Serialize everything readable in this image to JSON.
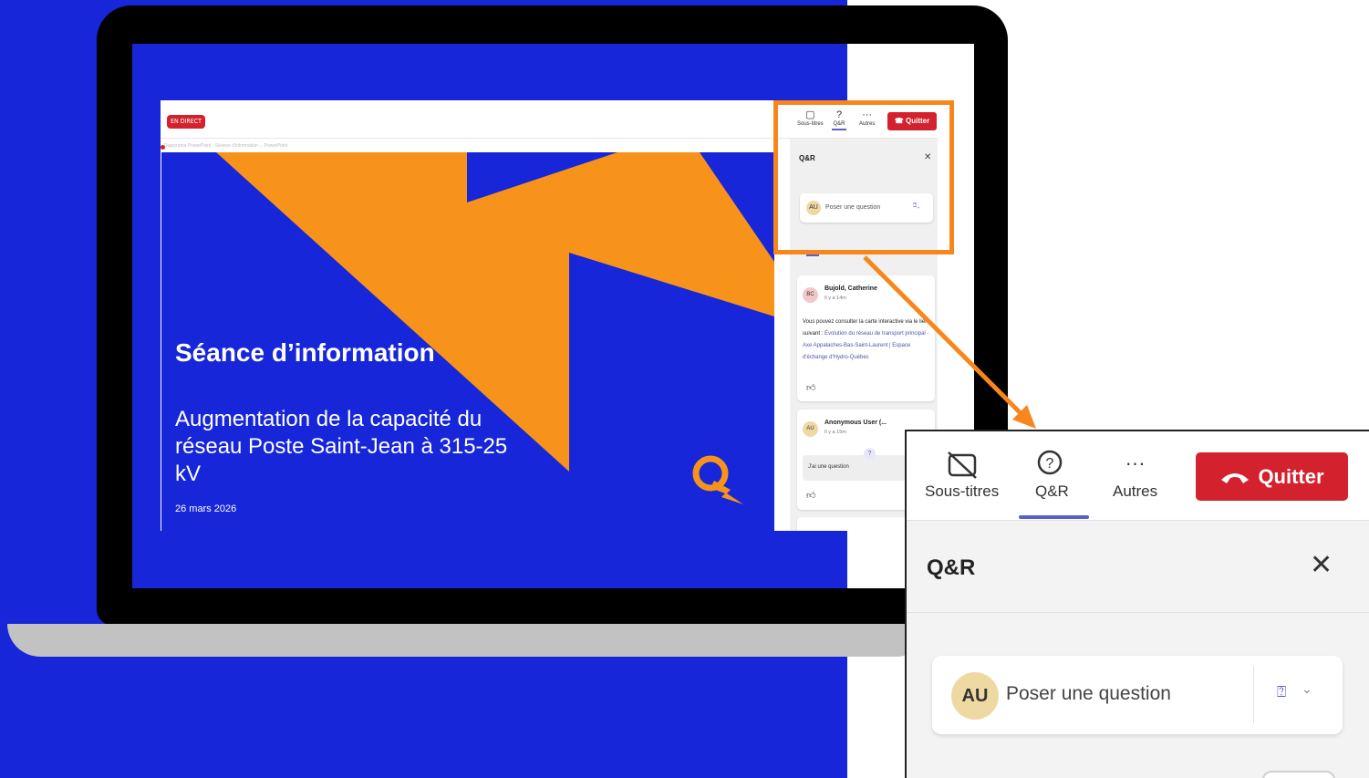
{
  "teams": {
    "live_badge": "EN DIRECT",
    "toolbar": {
      "captions_label": "Sous-titres",
      "qna_label": "Q&R",
      "more_label": "Autres",
      "quit_label": "Quitter"
    },
    "slide_caption": "Diaporama PowerPoint - Séance d'information ... PowerPoint"
  },
  "slide": {
    "title": "Séance d’information",
    "subtitle": "Augmentation de la capacité du réseau Poste Saint-Jean à 315-25 kV",
    "date": "26 mars 2026"
  },
  "qna_panel": {
    "title": "Q&R",
    "ask_avatar": "AU",
    "ask_placeholder": "Poser une question",
    "questions": [
      {
        "avatar": "BC",
        "author": "Bujold, Catherine",
        "time": "Il y a 14m",
        "text": "Vous pouvez consulter la carte interactive via le lien suivant : ",
        "link": "Évolution du réseau de transport principal - Axe Appalaches-Bas-Saint-Laurent | Espace d'échange d'Hydro-Québec"
      },
      {
        "avatar": "AU",
        "author": "Anonymous User (...",
        "time": "Il y a 15m",
        "text": "J'ai une question"
      }
    ]
  },
  "zoom": {
    "captions_label": "Sous-titres",
    "qna_label": "Q&R",
    "more_label": "Autres",
    "quit_label": "Quitter",
    "panel_title": "Q&R",
    "ask_avatar": "AU",
    "ask_placeholder": "Poser une question"
  },
  "colors": {
    "brand_blue": "#1726d8",
    "orange": "#f7871d",
    "quit_red": "#d3212d",
    "accent_purple": "#5b5fc7"
  }
}
